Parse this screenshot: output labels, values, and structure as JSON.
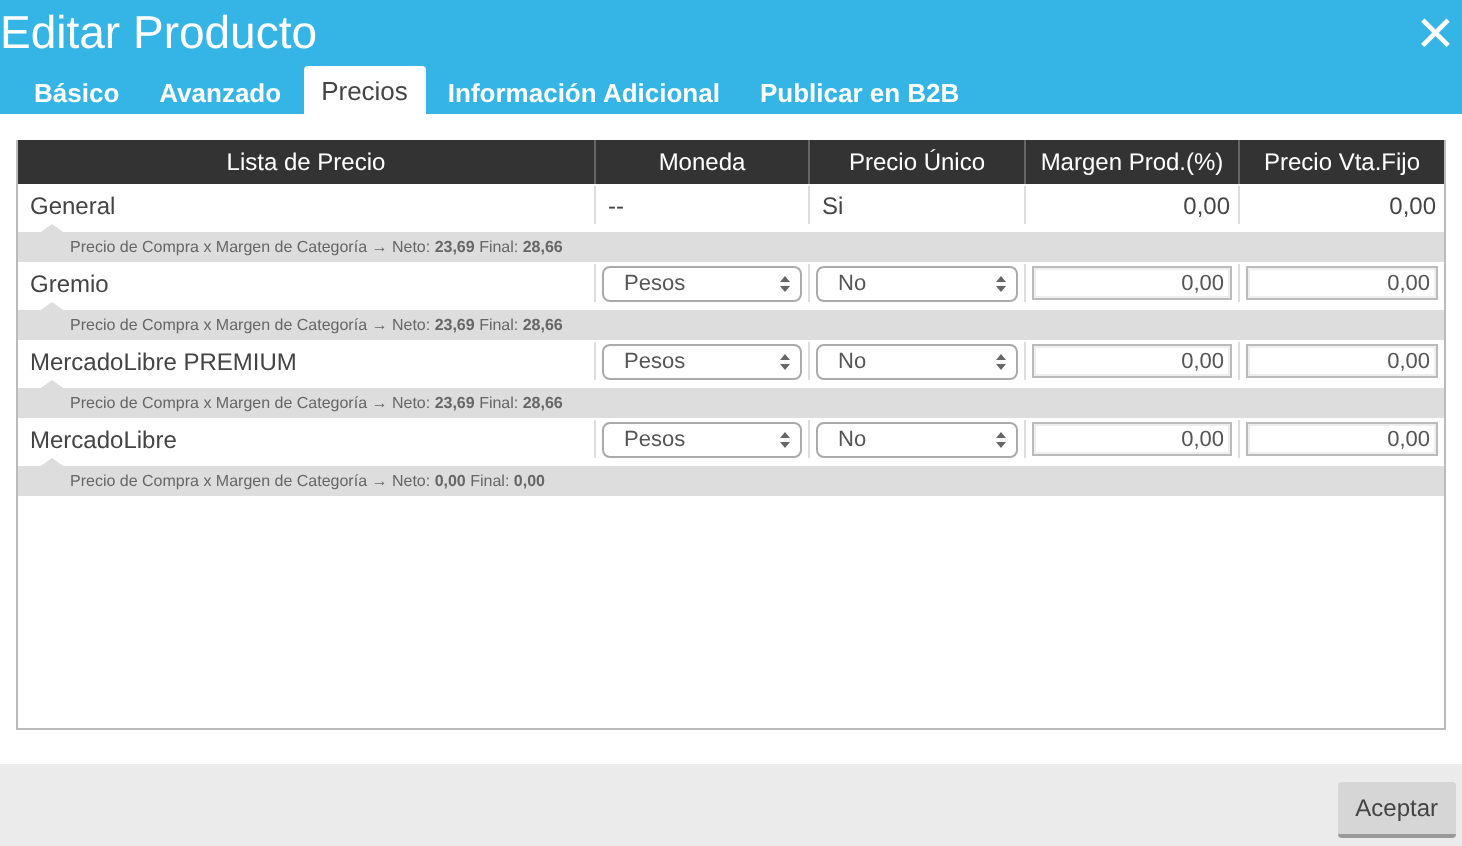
{
  "window": {
    "title": "Editar Producto",
    "close": "×"
  },
  "tabs": [
    {
      "label": "Básico",
      "selected": false
    },
    {
      "label": "Avanzado",
      "selected": false
    },
    {
      "label": "Precios",
      "selected": true
    },
    {
      "label": "Información Adicional",
      "selected": false
    },
    {
      "label": "Publicar en B2B",
      "selected": false
    }
  ],
  "table": {
    "columns": [
      "Lista de Precio",
      "Moneda",
      "Precio Único",
      "Margen Prod.(%)",
      "Precio Vta.Fijo"
    ],
    "rows": [
      {
        "kind": "static",
        "name": "General",
        "moneda": "--",
        "precio_unico": "Si",
        "margen": "0,00",
        "precio_fijo": "0,00",
        "detail": "Precio de Compra x Margen de Categoría → Neto: **23,69** Final: **28,66**"
      },
      {
        "kind": "editable",
        "name": "Gremio",
        "moneda": "Pesos",
        "precio_unico": "No",
        "margen": "0,00",
        "precio_fijo": "0,00",
        "detail": "Precio de Compra x Margen de Categoría → Neto: **23,69** Final: **28,66**"
      },
      {
        "kind": "editable",
        "name": "MercadoLibre PREMIUM",
        "moneda": "Pesos",
        "precio_unico": "No",
        "margen": "0,00",
        "precio_fijo": "0,00",
        "detail": "Precio de Compra x Margen de Categoría → Neto: **23,69** Final: **28,66**"
      },
      {
        "kind": "editable",
        "name": "MercadoLibre",
        "moneda": "Pesos",
        "precio_unico": "No",
        "margen": "0,00",
        "precio_fijo": "0,00",
        "detail": "Precio de Compra x Margen de Categoría → Neto: **0,00** Final: **0,00**"
      }
    ]
  },
  "buttons": [
    "Aceptar"
  ]
}
